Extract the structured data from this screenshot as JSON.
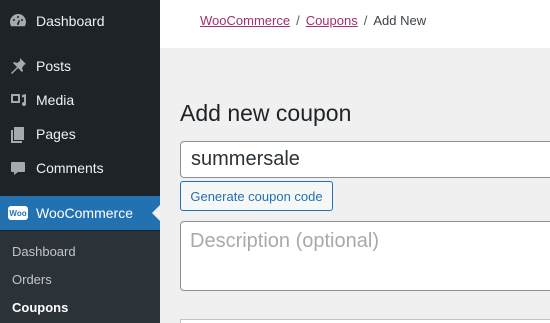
{
  "sidebar": {
    "items": [
      {
        "label": "Dashboard",
        "icon": "dashboard-icon"
      },
      {
        "label": "Posts",
        "icon": "pin-icon"
      },
      {
        "label": "Media",
        "icon": "media-icon"
      },
      {
        "label": "Pages",
        "icon": "pages-icon"
      },
      {
        "label": "Comments",
        "icon": "comments-icon"
      },
      {
        "label": "WooCommerce",
        "icon": "woocommerce-icon",
        "active": true
      }
    ],
    "woo_badge": "Woo",
    "submenu": [
      {
        "label": "Dashboard"
      },
      {
        "label": "Orders"
      },
      {
        "label": "Coupons",
        "current": true
      }
    ]
  },
  "breadcrumb": {
    "items": [
      "WooCommerce",
      "Coupons"
    ],
    "separator": "/",
    "current": "Add New"
  },
  "main": {
    "title": "Add new coupon",
    "coupon_code_value": "summersale",
    "generate_button": "Generate coupon code",
    "description_placeholder": "Description (optional)"
  },
  "colors": {
    "sidebar_bg": "#1d2327",
    "submenu_bg": "#2c3338",
    "accent": "#2271b1",
    "breadcrumb_link": "#a0316e"
  }
}
